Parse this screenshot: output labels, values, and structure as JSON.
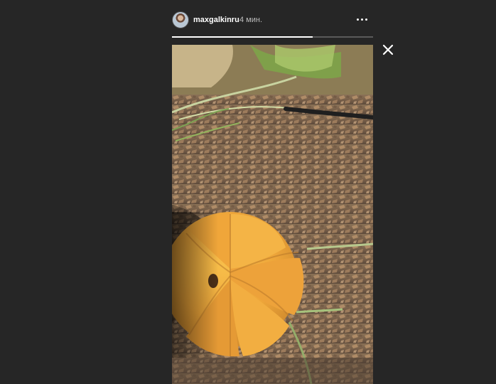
{
  "story": {
    "username": "maxgalkinru",
    "time": "4 мин.",
    "progress_fraction": 0.7
  },
  "icons": {
    "more": "more-options-icon",
    "close": "close-icon"
  },
  "colors": {
    "background": "#262626",
    "text": "#ffffff",
    "muted_text": "#bdbdbd",
    "progress_track": "#5a5a5a",
    "progress_fill": "#ffffff"
  }
}
